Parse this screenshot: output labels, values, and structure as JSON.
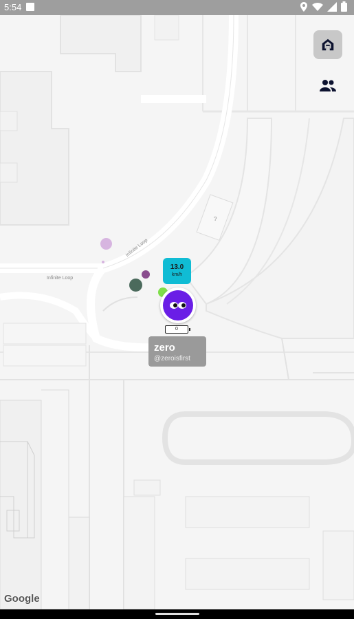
{
  "status_bar": {
    "time": "5:54",
    "icons": [
      "location-icon",
      "wifi-icon",
      "signal-icon",
      "battery-icon"
    ]
  },
  "map": {
    "labels": [
      "Infinite Loop",
      "Infinite Loop"
    ],
    "building_marker": "?",
    "attribution": "Google"
  },
  "buttons": {
    "home_icon": "home-icon",
    "friends_icon": "people-icon"
  },
  "user": {
    "speed_value": "13.0",
    "speed_unit": "km/h",
    "battery": "0",
    "name": "zero",
    "handle": "@zeroisfirst",
    "avatar_color": "#6a1ee6"
  },
  "colors": {
    "speed_badge": "#10bcd4",
    "home_button_bg": "#c8c8c8"
  }
}
